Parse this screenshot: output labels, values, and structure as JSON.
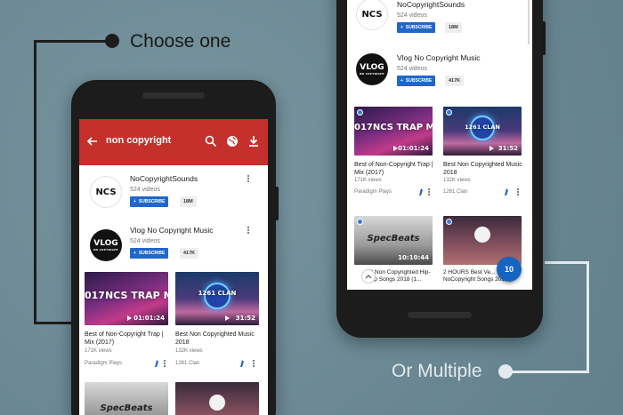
{
  "captions": {
    "top": "Choose one",
    "bottom": "Or Multiple"
  },
  "search": {
    "query": "non copyright"
  },
  "channels": [
    {
      "name": "NoCopyrightSounds",
      "videos": "524 videos",
      "subscribe": "SUBSCRIBE",
      "subscribers": "18M",
      "logo_text": "NCS"
    },
    {
      "name": "Vlog No Copyright Music",
      "videos": "524 videos",
      "subscribe": "SUBSCRIBE",
      "subscribers": "417K",
      "logo_text": "VLOG",
      "logo_sub": "NO COPYRIGHT"
    }
  ],
  "videos": [
    {
      "thumb_text": "017NCS TRAP MIX",
      "duration": "01:01:24",
      "title": "Best of Non-Copyright Trap | Mix (2017)",
      "views": "171K views",
      "channel": "Paradigm Plays"
    },
    {
      "thumb_text": "1261 CLAN",
      "duration": "31:52",
      "title": "Best Non Copyrighted Music 2018",
      "views": "132K views",
      "channel": "1261 Clan"
    },
    {
      "thumb_text": "SpecBeats",
      "duration": "10:10:44",
      "title": "20 Non Copyrighted Hip-Hop Songs 2018 (1...",
      "views": "",
      "channel": ""
    },
    {
      "thumb_text": "",
      "duration": "",
      "title": "2 HOURS Best Ve... Mix - NoCopyright Songs 2018 |",
      "views": "",
      "channel": ""
    }
  ],
  "selection": {
    "count": "10"
  },
  "colors": {
    "appbar": "#c4302b",
    "subscribe": "#2266c9",
    "fab": "#1565c0",
    "background": "#6e8c98"
  },
  "icons": [
    "back-arrow-icon",
    "search-icon",
    "globe-icon",
    "download-icon",
    "more-vert-icon",
    "add-icon",
    "download-mark-icon",
    "chevron-up-icon"
  ]
}
